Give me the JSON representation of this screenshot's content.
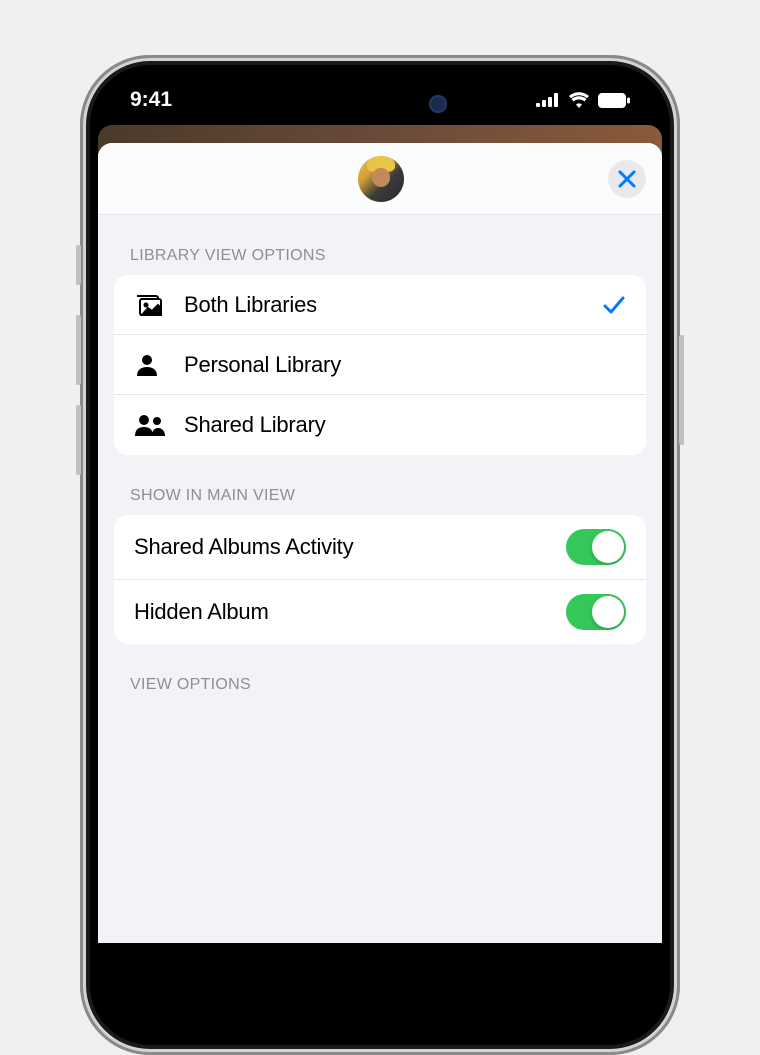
{
  "statusBar": {
    "time": "9:41"
  },
  "sections": {
    "libraryView": {
      "header": "LIBRARY VIEW OPTIONS",
      "options": [
        {
          "label": "Both Libraries",
          "selected": true
        },
        {
          "label": "Personal Library",
          "selected": false
        },
        {
          "label": "Shared Library",
          "selected": false
        }
      ]
    },
    "showInMain": {
      "header": "SHOW IN MAIN VIEW",
      "toggles": [
        {
          "label": "Shared Albums Activity",
          "on": true
        },
        {
          "label": "Hidden Album",
          "on": true
        }
      ]
    },
    "viewOptions": {
      "header": "VIEW OPTIONS"
    }
  }
}
